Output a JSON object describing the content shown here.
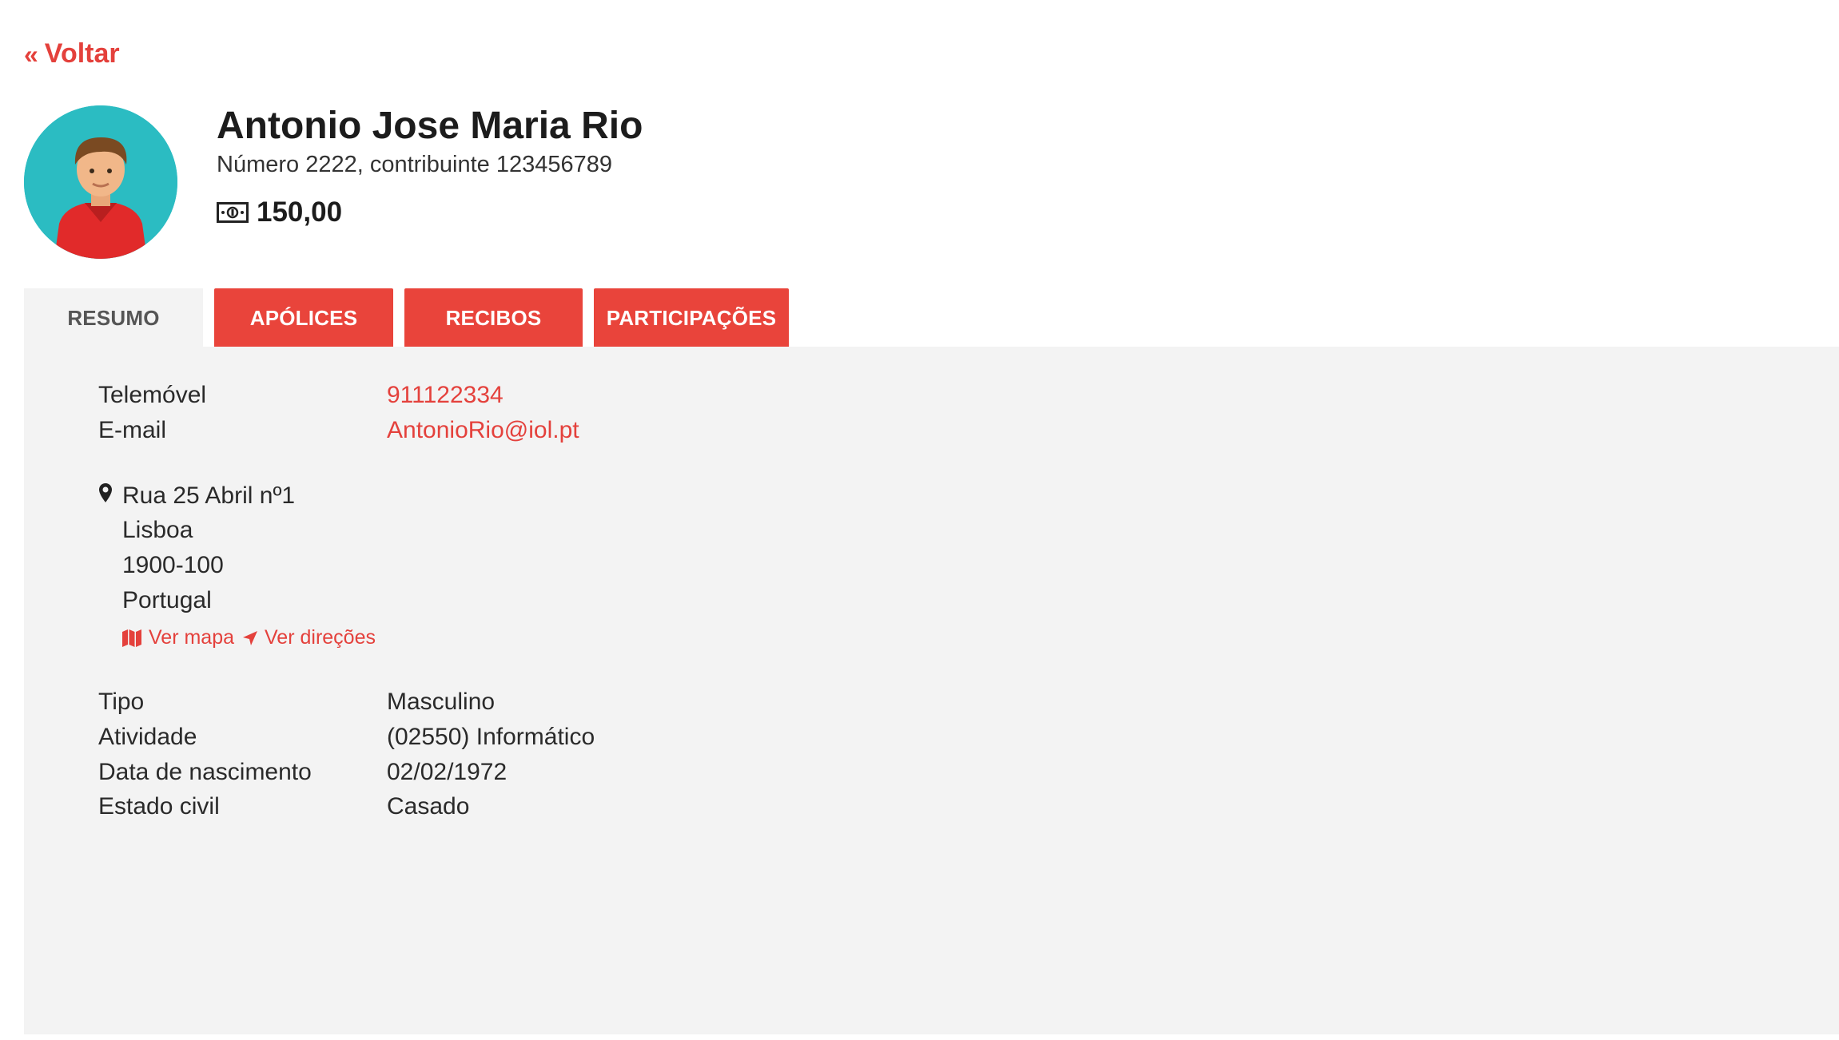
{
  "nav": {
    "back_label": "Voltar"
  },
  "client": {
    "name": "Antonio Jose Maria Rio",
    "subtitle": "Número 2222, contribuinte 123456789",
    "balance": "150,00"
  },
  "tabs": [
    {
      "label": "RESUMO",
      "active": true
    },
    {
      "label": "APÓLICES",
      "active": false
    },
    {
      "label": "RECIBOS",
      "active": false
    },
    {
      "label": "PARTICIPAÇÕES",
      "active": false
    }
  ],
  "contact": {
    "phone_label": "Telemóvel",
    "phone": "911122334",
    "email_label": "E-mail",
    "email": "AntonioRio@iol.pt"
  },
  "address": {
    "street": "Rua 25 Abril nº1",
    "city": "Lisboa",
    "postal_code": "1900-100",
    "country": "Portugal",
    "map_label": "Ver mapa",
    "directions_label": "Ver direções"
  },
  "details": [
    {
      "label": "Tipo",
      "value": "Masculino"
    },
    {
      "label": "Atividade",
      "value": "(02550) Informático"
    },
    {
      "label": "Data de nascimento",
      "value": "02/02/1972"
    },
    {
      "label": "Estado civil",
      "value": "Casado"
    }
  ],
  "colors": {
    "accent": "#e4413c",
    "tab_red": "#e9443b",
    "panel_bg": "#f3f3f3",
    "avatar_bg": "#2bbcc2"
  },
  "icons": {
    "back": "double-chevron-left-icon",
    "balance": "money-icon",
    "address": "map-pin-icon",
    "map": "map-icon",
    "directions": "location-arrow-icon"
  }
}
